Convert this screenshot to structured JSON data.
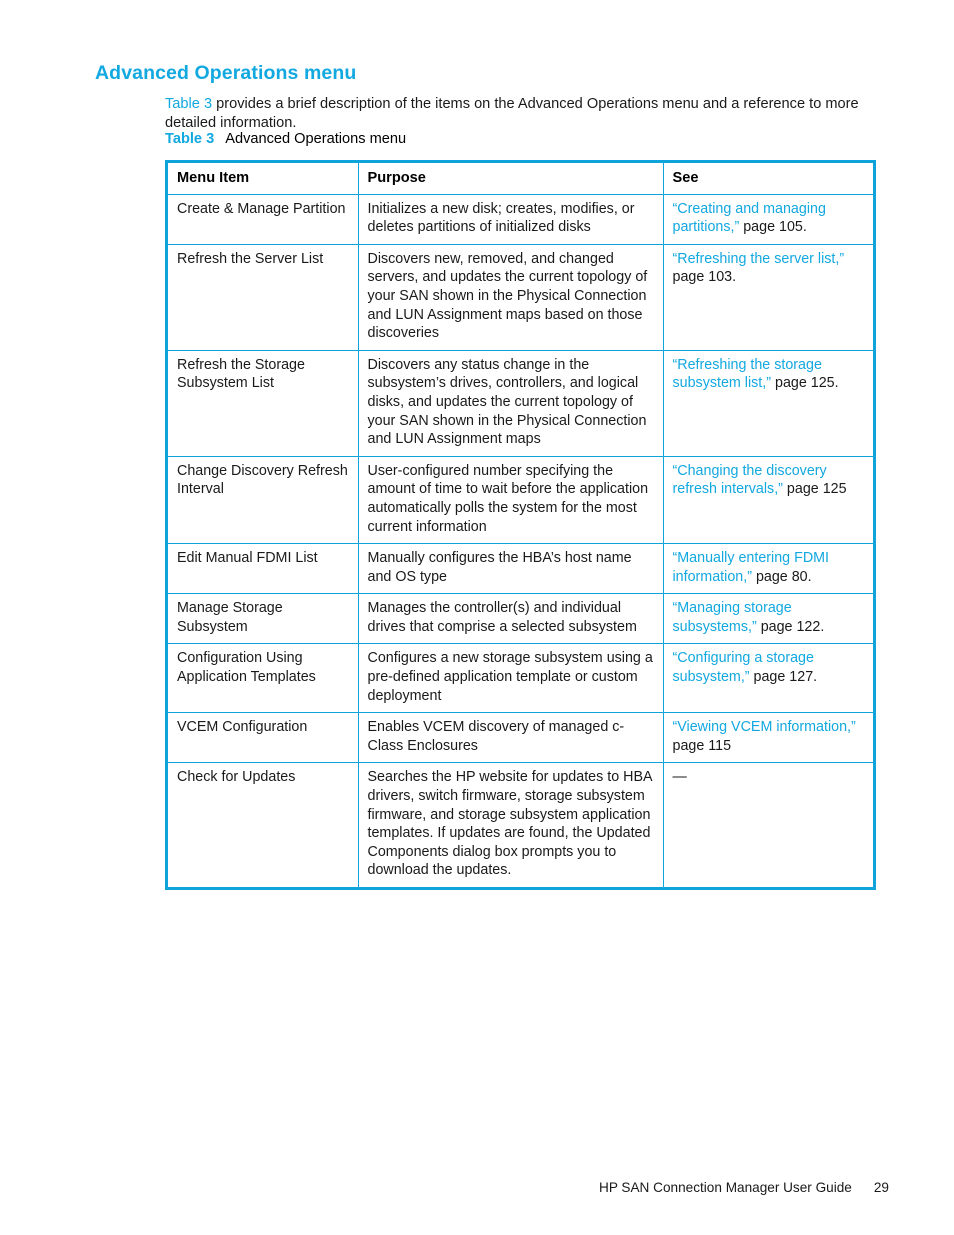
{
  "heading": "Advanced Operations menu",
  "intro": {
    "xref": "Table 3",
    "rest": " provides a brief description of the items on the Advanced Operations menu and a reference to more detailed information."
  },
  "table_caption": {
    "label": "Table 3",
    "title": "Advanced Operations menu"
  },
  "table": {
    "headers": {
      "menu_item": "Menu Item",
      "purpose": "Purpose",
      "see": "See"
    },
    "rows": [
      {
        "menu_item": "Create & Manage Partition",
        "purpose": "Initializes a new disk; creates, modifies, or deletes partitions of initialized disks",
        "see_link": "“Creating and managing partitions,”",
        "see_page": " page 105."
      },
      {
        "menu_item": "Refresh the Server List",
        "purpose": "Discovers new, removed, and changed servers, and updates the current topology of your SAN shown in the Physical Connection and LUN Assignment maps based on those discoveries",
        "see_link": "“Refreshing the server list,”",
        "see_page": " page 103."
      },
      {
        "menu_item": "Refresh the Storage Subsystem List",
        "purpose": "Discovers any status change in the subsystem’s drives, controllers, and logical disks, and updates the current topology of your SAN shown in the Physical Connection and LUN Assignment maps",
        "see_link": "“Refreshing the storage subsystem list,”",
        "see_page": " page 125."
      },
      {
        "menu_item": "Change Discovery Refresh Interval",
        "purpose": "User-configured number specifying the amount of time to wait before the application automatically polls the system for the most current information",
        "see_link": "“Changing the discovery refresh intervals,”",
        "see_page": " page 125"
      },
      {
        "menu_item": "Edit Manual FDMI List",
        "purpose": "Manually configures the HBA’s host name and OS type",
        "see_link": "“Manually entering FDMI information,”",
        "see_page": " page 80."
      },
      {
        "menu_item": "Manage Storage Subsystem",
        "purpose": "Manages the controller(s) and individual drives that comprise a selected subsystem",
        "see_link": "“Managing storage subsystems,”",
        "see_page": " page 122."
      },
      {
        "menu_item": "Configuration Using Application Templates",
        "purpose": "Configures a new storage subsystem using a pre-defined application template or custom deployment",
        "see_link": "“Configuring a storage subsystem,”",
        "see_page": " page 127."
      },
      {
        "menu_item": "VCEM Configuration",
        "purpose": "Enables VCEM discovery of managed c-Class Enclosures",
        "see_link": "“Viewing VCEM information,”",
        "see_page": " page 115"
      },
      {
        "menu_item": "Check for Updates",
        "purpose": "Searches the HP website for updates to HBA drivers, switch firmware, storage subsystem firmware, and storage subsystem application templates. If updates are found, the Updated Components dialog box prompts you to download the updates.",
        "see_link": "",
        "see_page": "—"
      }
    ]
  },
  "footer": {
    "guide": "HP SAN Connection Manager User Guide",
    "page_number": "29"
  },
  "colors": {
    "accent": "#12a8e0",
    "table_border": "#0fa3dc",
    "text": "#1a1a1a"
  }
}
